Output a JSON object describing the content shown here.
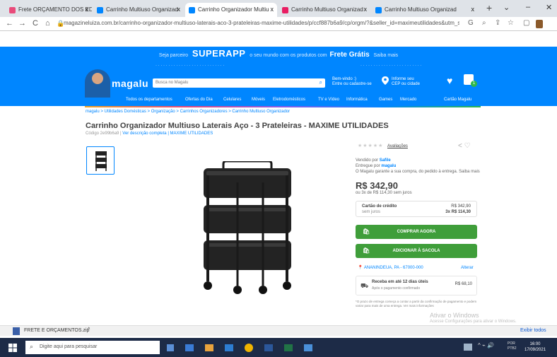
{
  "browser": {
    "tabs": [
      {
        "label": "Frete ORÇAMENTO DOS EDLI",
        "color": "#e94b7a"
      },
      {
        "label": "Carrinho Multiuso Organizad",
        "color": "#0086ff"
      },
      {
        "label": "Carrinho Organizador Multiu",
        "color": "#0086ff"
      },
      {
        "label": "Carrinho Multiuso Organizad",
        "color": "#e91e63"
      },
      {
        "label": "Carrinho Multiuso Organizad",
        "color": "#0086ff"
      }
    ],
    "close_glyph": "x",
    "new_tab_glyph": "+",
    "url": "magazineluiza.com.br/carrinho-organizador-multiuso-laterais-aco-3-prateleiras-maxime-utilidades/p/ccf887b6a9/cp/orgm/?&seller_id=maximeutilidades&utm_source=google",
    "nav": {
      "back": "←",
      "forward": "→",
      "reload": "C",
      "home": "⌂"
    }
  },
  "header": {
    "promo_left": "Seja parceiro",
    "superapp": "SUPERAPP",
    "promo_mid": "o seu mundo com os produtos com",
    "frete": "Frete Grátis",
    "promo_right": "Saiba mais",
    "logo": "magalu",
    "search_placeholder": "Busca no Magalu",
    "account": [
      "Bem-vindo :)",
      "Entre ou cadastre-se"
    ],
    "location": [
      "Informe seu",
      "CEP ou cidade"
    ],
    "categories": [
      "Todos os departamentos",
      "Ofertas do Dia",
      "Celulares",
      "Móveis",
      "Eletrodomésticos",
      "TV e Vídeo",
      "Informática",
      "Games",
      "Mercado",
      "Cartão Magalu"
    ]
  },
  "product": {
    "breadcrumb": "magalu > Utilidades Domésticas > Organização > Carrinhos Organizadores > Carrinho Multiuso Organizador",
    "title": "Carrinho Organizador Multiuso Laterais Aço - 3 Prateleiras - MAXIME UTILIDADES",
    "subtitle_prefix": "Código 2e99b6a9 |",
    "subtitle_link": "Ver descrição completa | MAXIME UTILIDADES",
    "reviews_link": "Avaliações",
    "seller_label": "Vendido por",
    "seller_name": "Safile",
    "delivery_label": "Entregue por",
    "delivery_name": "magalu",
    "seller_note": "O Magalu garante a sua compra, do pedido à entrega. Saiba mais",
    "price": "R$ 342,90",
    "installments": "ou 3x de R$ 114,30 sem juros",
    "card_label": "Cartão de crédito",
    "card_sub": "sem juros",
    "card_price": "R$ 342,90",
    "card_inst": "3x R$ 114,30",
    "buy_button": "COMPRAR AGORA",
    "bag_button": "ADICIONAR À SACOLA",
    "cep": "ANANINDEUA, PA - 67000-000",
    "cep_change": "Alterar",
    "shipping_title": "Receba em até 12 dias úteis",
    "shipping_sub": "Após o pagamento confirmado",
    "shipping_price": "R$ 68,10",
    "shipping_note": "*O prazo de entrega começa a contar a partir da confirmação de pagamento e podem variar para mais de uma entrega. Ver mais informações"
  },
  "downloads": {
    "file": "FRETE E ORÇAMENTOS.zip",
    "show_all": "Exibir todos"
  },
  "watermark": {
    "line1": "Ativar o Windows",
    "line2": "Acesse Configurações para ativar o Windows."
  },
  "taskbar": {
    "search_placeholder": "Digite aqui para pesquisar",
    "time": "16:00",
    "date": "17/09/2021",
    "lang": "POR\nPTB2"
  }
}
